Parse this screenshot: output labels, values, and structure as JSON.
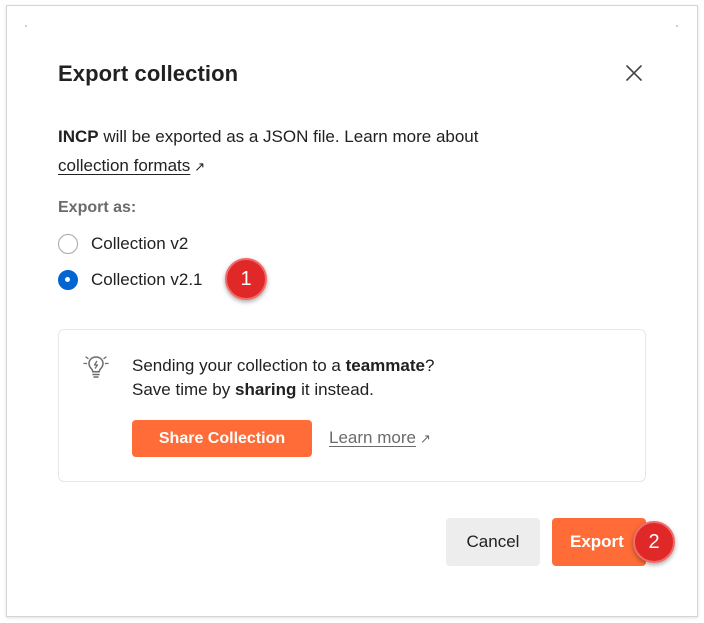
{
  "dialog": {
    "title": "Export collection",
    "close_icon": "close-icon"
  },
  "description": {
    "collection_name": "INCP",
    "text": " will be exported as a JSON file. Learn more about",
    "link": "collection formats",
    "link_icon": "external-arrow-icon"
  },
  "export_as": {
    "label": "Export as:",
    "options": [
      {
        "label": "Collection v2",
        "checked": false
      },
      {
        "label": "Collection v2.1",
        "checked": true
      }
    ]
  },
  "tip": {
    "icon": "lightbulb-icon",
    "line1_pre": "Sending your collection to a ",
    "line1_bold": "teammate",
    "line1_post": "?",
    "line2_pre": "Save time by ",
    "line2_bold": "sharing",
    "line2_post": " it instead.",
    "share_button": "Share Collection",
    "learn_more": "Learn more"
  },
  "footer": {
    "cancel": "Cancel",
    "export": "Export"
  },
  "annotations": {
    "badge_1": "1",
    "badge_2": "2"
  },
  "colors": {
    "accent": "#ff6c37",
    "radio_checked": "#0265d2",
    "badge": "#e02828"
  }
}
